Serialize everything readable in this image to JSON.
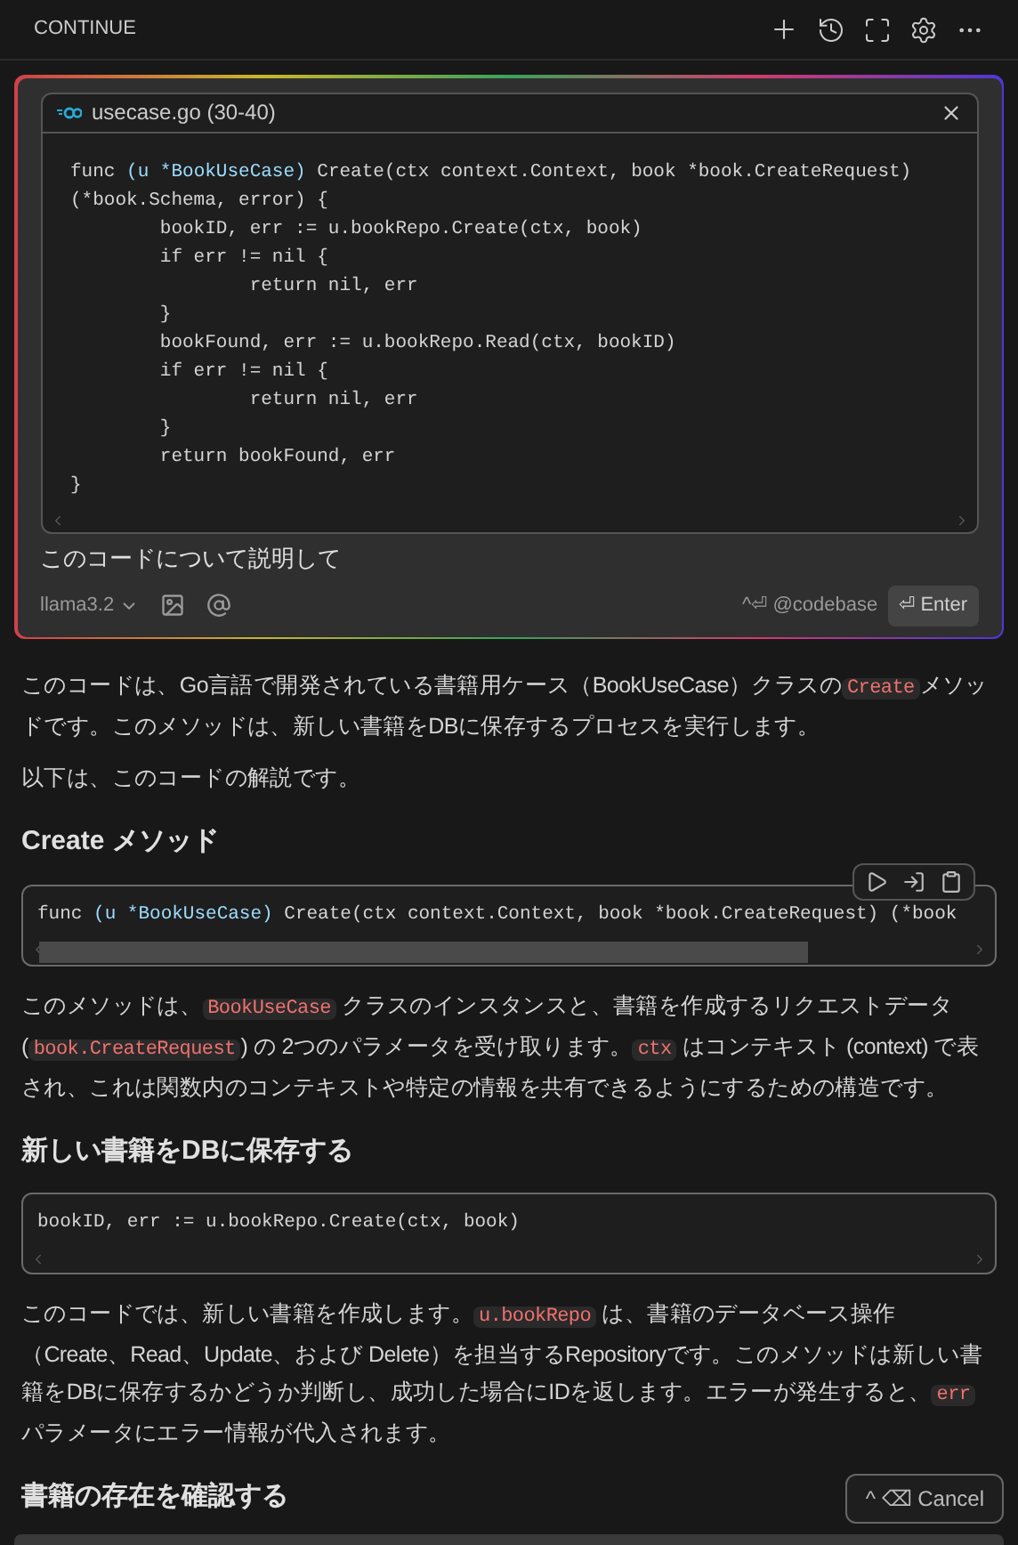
{
  "header": {
    "title": "CONTINUE"
  },
  "input": {
    "context": {
      "file": "usecase.go (30-40)",
      "lines": [
        [
          {
            "kind": "plain",
            "text": "func "
          },
          {
            "kind": "type",
            "text": "(u *BookUseCase)"
          },
          {
            "kind": "plain",
            "text": " Create(ctx context.Context, book *book.CreateRequest)"
          }
        ],
        [
          {
            "kind": "plain",
            "text": "(*book.Schema, error) {"
          }
        ],
        [
          {
            "kind": "plain",
            "text": "        bookID, err := u.bookRepo.Create(ctx, book)"
          }
        ],
        [
          {
            "kind": "plain",
            "text": "        if err != nil {"
          }
        ],
        [
          {
            "kind": "plain",
            "text": "                return nil, err"
          }
        ],
        [
          {
            "kind": "plain",
            "text": "        }"
          }
        ],
        [
          {
            "kind": "plain",
            "text": "        bookFound, err := u.bookRepo.Read(ctx, bookID)"
          }
        ],
        [
          {
            "kind": "plain",
            "text": "        if err != nil {"
          }
        ],
        [
          {
            "kind": "plain",
            "text": "                return nil, err"
          }
        ],
        [
          {
            "kind": "plain",
            "text": "        }"
          }
        ],
        [
          {
            "kind": "plain",
            "text": "        return bookFound, err"
          }
        ],
        [
          {
            "kind": "plain",
            "text": "}"
          }
        ]
      ]
    },
    "prompt": "このコードについて説明して",
    "model": "llama3.2",
    "codebase": "^⏎ @codebase",
    "enter": "⏎ Enter"
  },
  "response": [
    {
      "kind": "paragraph",
      "segments": [
        {
          "kind": "text",
          "text": "このコードは、Go言語で開発されている書籍用ケース（BookUseCase）クラスの"
        },
        {
          "kind": "code",
          "text": "Create"
        },
        {
          "kind": "text",
          "text": "メソッドです。このメソッドは、新しい書籍をDBに保存するプロセスを実行します。"
        }
      ]
    },
    {
      "kind": "paragraph",
      "segments": [
        {
          "kind": "text",
          "text": "以下は、このコードの解説です。"
        }
      ]
    },
    {
      "kind": "heading",
      "text": "Create メソッド"
    },
    {
      "kind": "code",
      "toolbar": true,
      "scrollbar": true,
      "lines": [
        [
          {
            "kind": "plain",
            "text": "func "
          },
          {
            "kind": "type",
            "text": "(u *BookUseCase)"
          },
          {
            "kind": "plain",
            "text": " Create(ctx context.Context, book *book.CreateRequest) (*book"
          }
        ]
      ]
    },
    {
      "kind": "paragraph",
      "segments": [
        {
          "kind": "text",
          "text": "このメソッドは、"
        },
        {
          "kind": "code",
          "text": "BookUseCase"
        },
        {
          "kind": "text",
          "text": " クラスのインスタンスと、書籍を作成するリクエストデータ ("
        },
        {
          "kind": "code",
          "text": "book.CreateRequest"
        },
        {
          "kind": "text",
          "text": ") の 2つのパラメータを受け取ります。"
        },
        {
          "kind": "code",
          "text": "ctx"
        },
        {
          "kind": "text",
          "text": " はコンテキスト (context) で表され、これは関数内のコンテキストや特定の情報を共有できるようにするための構造です。"
        }
      ]
    },
    {
      "kind": "heading",
      "text": "新しい書籍をDBに保存する"
    },
    {
      "kind": "code",
      "toolbar": false,
      "scrollbar": false,
      "lines": [
        [
          {
            "kind": "plain",
            "text": "bookID, err := u.bookRepo.Create(ctx, book)"
          }
        ]
      ]
    },
    {
      "kind": "paragraph",
      "segments": [
        {
          "kind": "text",
          "text": "このコードでは、新しい書籍を作成します。"
        },
        {
          "kind": "code",
          "text": "u.bookRepo"
        },
        {
          "kind": "text",
          "text": " は、書籍のデータベース操作（Create、Read、Update、および Delete）を担当するRepositoryです。このメソッドは新しい書籍をDBに保存するかどうか判断し、成功した場合にIDを返します。エラーが発生すると、"
        },
        {
          "kind": "code",
          "text": "err"
        },
        {
          "kind": "text",
          "text": " パラメータにエラー情報が代入されます。"
        }
      ]
    },
    {
      "kind": "heading",
      "text": "書籍の存在を確認する"
    }
  ],
  "cancel": "^ ⌫ Cancel"
}
